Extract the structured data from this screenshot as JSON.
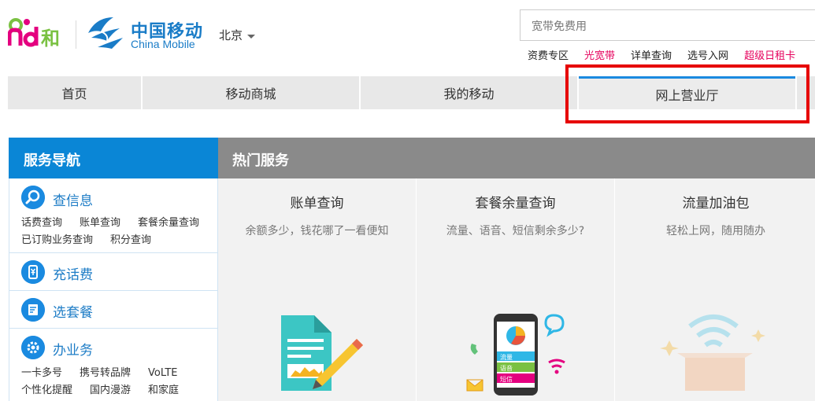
{
  "header": {
    "brand_cn": "中国移动",
    "brand_en": "China Mobile",
    "city": "北京",
    "search_placeholder": "宽带免费用",
    "quick_links": [
      {
        "label": "资费专区",
        "hot": false
      },
      {
        "label": "光宽带",
        "hot": true
      },
      {
        "label": "详单查询",
        "hot": false
      },
      {
        "label": "选号入网",
        "hot": false
      },
      {
        "label": "超级日租卡",
        "hot": true
      }
    ]
  },
  "nav": {
    "tabs": [
      "首页",
      "移动商城",
      "我的移动",
      "网上营业厅"
    ],
    "active_index": 3
  },
  "service_nav": {
    "heading": "服务导航",
    "items": [
      {
        "title": "查信息",
        "icon": "search-icon",
        "links": [
          "话费查询",
          "账单查询",
          "套餐余量查询",
          "已订购业务查询",
          "积分查询"
        ]
      },
      {
        "title": "充话费",
        "icon": "yuan-phone-icon",
        "links": []
      },
      {
        "title": "选套餐",
        "icon": "package-icon",
        "links": []
      },
      {
        "title": "办业务",
        "icon": "gear-icon",
        "links": [
          "一卡多号",
          "携号转品牌",
          "VoLTE",
          "个性化提醒",
          "国内漫游",
          "和家庭"
        ]
      }
    ]
  },
  "hot_services": {
    "heading": "热门服务",
    "cards": [
      {
        "title": "账单查询",
        "desc": "余额多少，钱花哪了一看便知"
      },
      {
        "title": "套餐余量查询",
        "desc": "流量、语音、短信剩余多少?",
        "phone_rows": [
          "流量",
          "语音",
          "短信"
        ]
      },
      {
        "title": "流量加油包",
        "desc": "轻松上网，随用随办"
      }
    ]
  },
  "colors": {
    "brand_blue": "#0a86d6",
    "highlight_red": "#e60000",
    "hot_link": "#e6005c"
  }
}
